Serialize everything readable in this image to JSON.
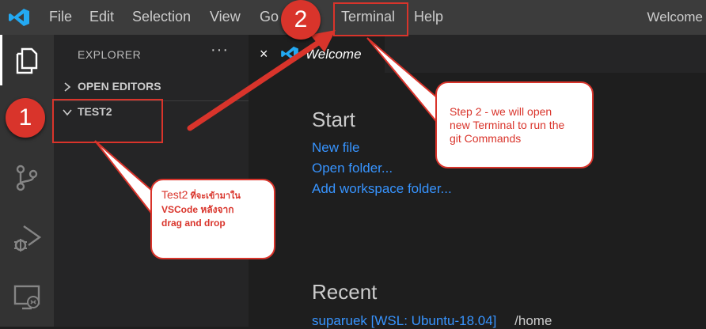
{
  "menubar": {
    "items": [
      "File",
      "Edit",
      "Selection",
      "View",
      "Go",
      "Terminal",
      "Help"
    ],
    "window_title": "Welcome"
  },
  "activitybar": {
    "icons": [
      "explorer-icon",
      "source-control-icon",
      "run-debug-icon",
      "remote-explorer-icon"
    ]
  },
  "sidebar": {
    "title": "EXPLORER",
    "more_actions": "···",
    "sections": [
      {
        "label": "OPEN EDITORS",
        "expanded": false
      },
      {
        "label": "TEST2",
        "expanded": true
      }
    ]
  },
  "editor": {
    "tab": {
      "label": "Welcome",
      "close": "×"
    },
    "start": {
      "heading": "Start",
      "links": [
        "New file",
        "Open folder...",
        "Add workspace folder..."
      ]
    },
    "recent": {
      "heading": "Recent",
      "item_name": "suparuek [WSL: Ubuntu-18.04]",
      "item_path": "/home"
    }
  },
  "annotations": {
    "badge_1": "1",
    "badge_2": "2",
    "callout_test2": {
      "line1": "Test2",
      "line1_thai": " ที่จะเข้ามาใน",
      "line2": "VSCode หลังจาก",
      "line3": "drag and drop"
    },
    "callout_step2": {
      "line1": "Step 2 - we will open",
      "line2": "new Terminal to run the",
      "line3": "git Commands"
    }
  },
  "colors": {
    "accent_red": "#d9342b",
    "link_blue": "#3794ff",
    "vscode_blue": "#23a9f2"
  }
}
